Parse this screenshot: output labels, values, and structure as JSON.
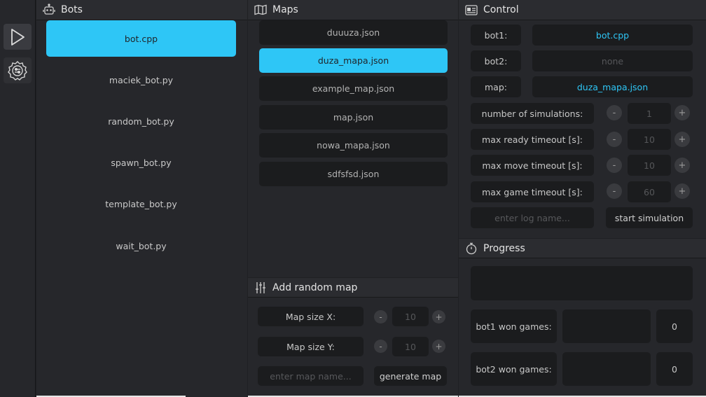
{
  "bots": {
    "title": "Bots",
    "items": [
      "bot.cpp",
      "maciek_bot.py",
      "random_bot.py",
      "spawn_bot.py",
      "template_bot.py",
      "wait_bot.py"
    ],
    "selected_index": 0
  },
  "maps": {
    "title": "Maps",
    "items": [
      "duuuza.json",
      "duza_mapa.json",
      "example_map.json",
      "map.json",
      "nowa_mapa.json",
      "sdfsfsd.json"
    ],
    "selected_index": 1
  },
  "add_random_map": {
    "title": "Add random map",
    "size_x_label": "Map size X:",
    "size_x_value": "10",
    "size_y_label": "Map size Y:",
    "size_y_value": "10",
    "name_placeholder": "enter map name...",
    "generate_label": "generate map",
    "minus": "-",
    "plus": "+"
  },
  "control": {
    "title": "Control",
    "bot1_label": "bot1:",
    "bot1_value": "bot.cpp",
    "bot2_label": "bot2:",
    "bot2_value": "none",
    "map_label": "map:",
    "map_value": "duza_mapa.json",
    "num_sim_label": "number of simulations:",
    "num_sim_value": "1",
    "ready_timeout_label": "max ready timeout [s]:",
    "ready_timeout_value": "10",
    "move_timeout_label": "max move timeout [s]:",
    "move_timeout_value": "10",
    "game_timeout_label": "max game timeout [s]:",
    "game_timeout_value": "60",
    "log_placeholder": "enter log name...",
    "start_label": "start simulation",
    "minus": "-",
    "plus": "+"
  },
  "progress": {
    "title": "Progress",
    "bot1_won_label": "bot1 won games:",
    "bot1_won_value": "0",
    "bot2_won_label": "bot2 won games:",
    "bot2_won_value": "0"
  },
  "colors": {
    "accent": "#2ec6f6",
    "background": "#1f2023",
    "panel": "#26272b",
    "field": "#1b1c1e"
  }
}
